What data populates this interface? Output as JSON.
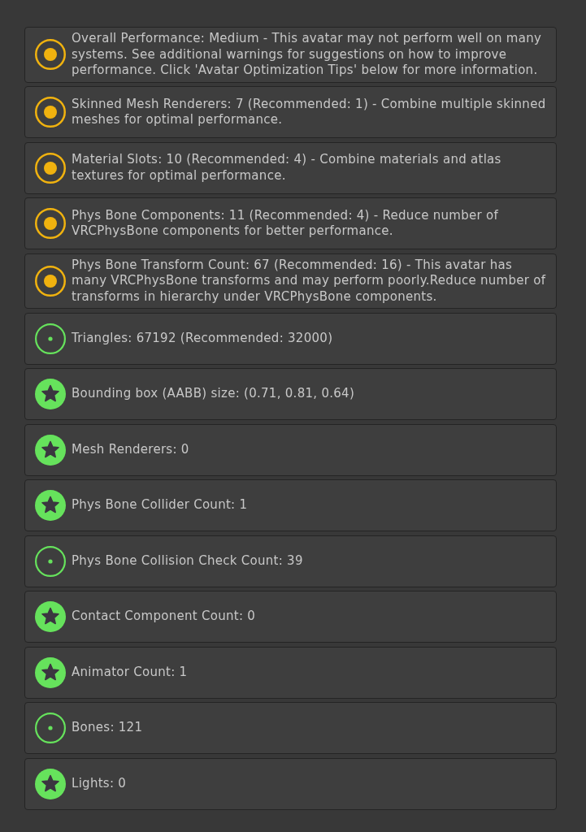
{
  "panel": {
    "items": [
      {
        "kind": "medium",
        "text": "Overall Performance: Medium - This avatar may not perform well on many systems. See additional warnings for suggestions on how to improve performance. Click 'Avatar Optimization Tips' below for more information."
      },
      {
        "kind": "medium",
        "text": "Skinned Mesh Renderers: 7 (Recommended: 1) - Combine multiple skinned meshes for optimal performance."
      },
      {
        "kind": "medium",
        "text": "Material Slots: 10 (Recommended: 4) - Combine materials and atlas textures for optimal performance."
      },
      {
        "kind": "medium",
        "text": "Phys Bone Components: 11 (Recommended: 4) - Reduce number of VRCPhysBone components for better performance."
      },
      {
        "kind": "medium",
        "text": "Phys Bone Transform Count: 67 (Recommended: 16) - This avatar has many VRCPhysBone transforms and may perform poorly.Reduce number of transforms in hierarchy under VRCPhysBone components."
      },
      {
        "kind": "good",
        "text": "Triangles: 67192 (Recommended: 32000)"
      },
      {
        "kind": "excellent",
        "text": "Bounding box (AABB) size: (0.71, 0.81, 0.64)"
      },
      {
        "kind": "excellent",
        "text": "Mesh Renderers: 0"
      },
      {
        "kind": "excellent",
        "text": "Phys Bone Collider Count: 1"
      },
      {
        "kind": "good",
        "text": "Phys Bone Collision Check Count: 39"
      },
      {
        "kind": "excellent",
        "text": "Contact Component Count: 0"
      },
      {
        "kind": "excellent",
        "text": "Animator Count: 1"
      },
      {
        "kind": "good",
        "text": "Bones: 121"
      },
      {
        "kind": "excellent",
        "text": "Lights: 0"
      }
    ]
  }
}
